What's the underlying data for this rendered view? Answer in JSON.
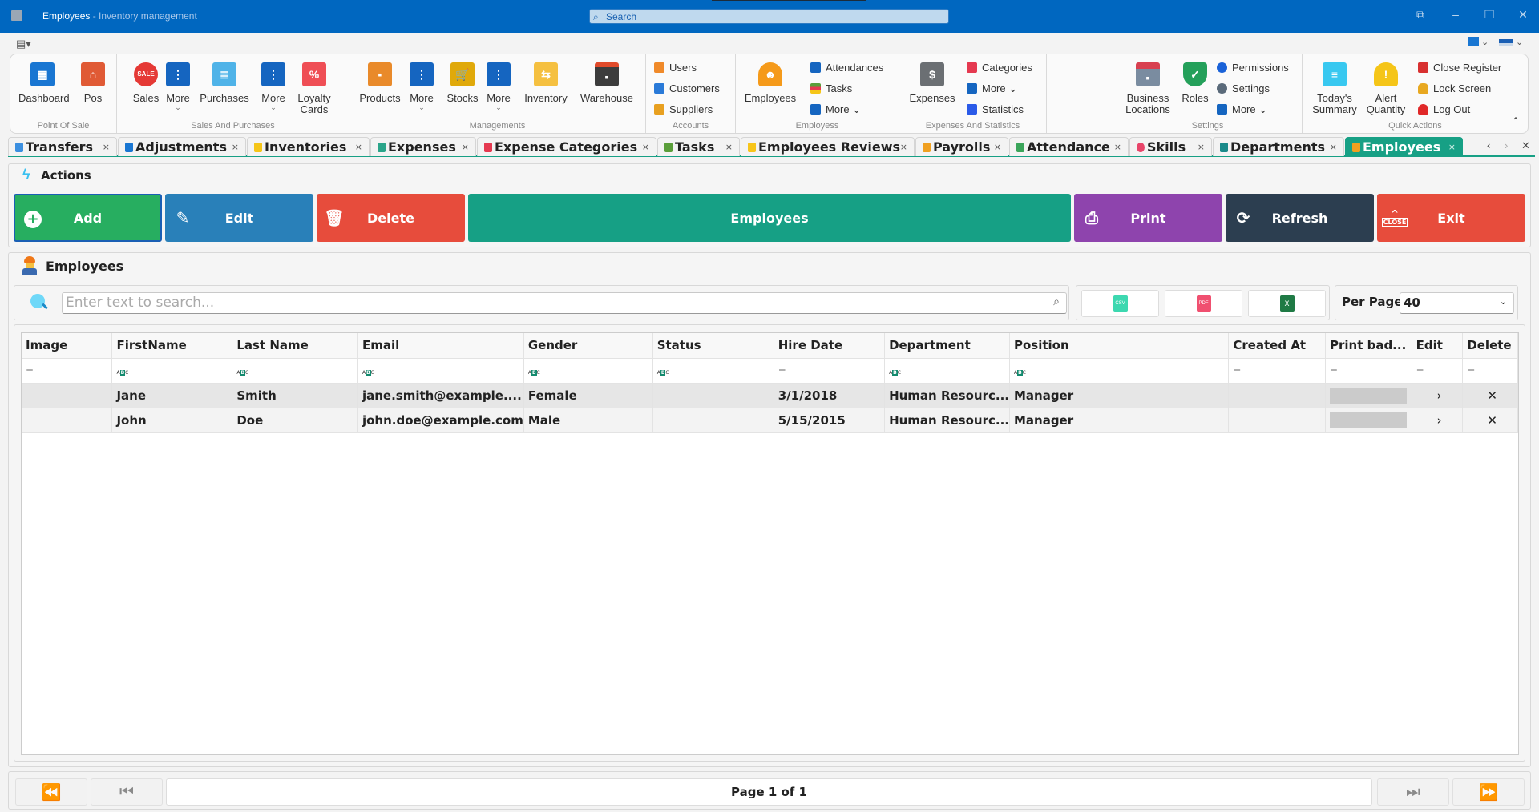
{
  "window": {
    "title": "Employees",
    "subtitle": " - Inventory management",
    "search_placeholder": "Search",
    "controls": {
      "restore_icon": "⧉",
      "minimize": "–",
      "maximize": "❐",
      "close": "✕"
    }
  },
  "ribbon": {
    "groups": [
      {
        "caption": "Point Of Sale",
        "items": [
          {
            "label": "Dashboard"
          },
          {
            "label": "Pos"
          }
        ]
      },
      {
        "caption": "Sales And Purchases",
        "items": [
          {
            "label": "Sales"
          },
          {
            "label": "More"
          },
          {
            "label": "Purchases"
          },
          {
            "label": "More"
          },
          {
            "label": "Loyalty Cards"
          }
        ]
      },
      {
        "caption": "Managements",
        "items": [
          {
            "label": "Products"
          },
          {
            "label": "More"
          },
          {
            "label": "Stocks"
          },
          {
            "label": "More"
          },
          {
            "label": "Inventory"
          },
          {
            "label": "Warehouse"
          }
        ]
      },
      {
        "caption": "Accounts",
        "items": [
          {
            "label": "Users"
          },
          {
            "label": "Customers"
          },
          {
            "label": "Suppliers"
          }
        ]
      },
      {
        "caption": "Employess",
        "items": [
          {
            "label": "Employees"
          },
          {
            "label": "Attendances"
          },
          {
            "label": "Tasks"
          },
          {
            "label": "More ⌄"
          }
        ]
      },
      {
        "caption": "Expenses And Statistics",
        "items": [
          {
            "label": "Expenses"
          },
          {
            "label": "Categories"
          },
          {
            "label": "More ⌄"
          },
          {
            "label": "Statistics"
          }
        ]
      },
      {
        "caption": "Settings",
        "items": [
          {
            "label": "Business Locations"
          },
          {
            "label": "Roles"
          },
          {
            "label": "Permissions"
          },
          {
            "label": "Settings"
          },
          {
            "label": "More ⌄"
          }
        ]
      },
      {
        "caption": "Quick Actions",
        "items": [
          {
            "label": "Today's Summary"
          },
          {
            "label": "Alert Quantity"
          },
          {
            "label": "Close Register"
          },
          {
            "label": "Lock Screen"
          },
          {
            "label": "Log Out"
          }
        ]
      }
    ]
  },
  "tabs": [
    {
      "label": "Transfers",
      "color": "#3b8fe0"
    },
    {
      "label": "Adjustments",
      "color": "#1976d2"
    },
    {
      "label": "Inventories",
      "color": "#f5c518"
    },
    {
      "label": "Expenses",
      "color": "#2aa58a"
    },
    {
      "label": "Expense Categories",
      "color": "#e53950"
    },
    {
      "label": "Tasks",
      "color": "#5a9e3a"
    },
    {
      "label": "Employees Reviews",
      "color": "#f7c51a"
    },
    {
      "label": "Payrolls",
      "color": "#f0a020"
    },
    {
      "label": "Attendance",
      "color": "#3aa55a"
    },
    {
      "label": "Skills",
      "color": "#e8456a"
    },
    {
      "label": "Departments",
      "color": "#1a8a8a"
    },
    {
      "label": "Employees",
      "color": "#f0a020",
      "active": true
    }
  ],
  "tab_close": "×",
  "tab_nav": {
    "prev": "‹",
    "next": "›",
    "close": "✕"
  },
  "actions": {
    "title": "Actions",
    "buttons": [
      {
        "label": "Add",
        "color": "#27ae60"
      },
      {
        "label": "Edit",
        "color": "#2980b9"
      },
      {
        "label": "Delete",
        "color": "#e74c3c"
      },
      {
        "label": "Employees",
        "color": "#16a085"
      },
      {
        "label": "Print",
        "color": "#8e44ad"
      },
      {
        "label": "Refresh",
        "color": "#2c3e50"
      },
      {
        "label": "Exit",
        "color": "#e74c3c"
      }
    ]
  },
  "employees_panel": {
    "title": "Employees",
    "search_placeholder": "Enter text to search...",
    "export": {
      "csv": "CSV",
      "pdf": "PDF",
      "excel": "X"
    },
    "per_page_label": "Per Page",
    "per_page_value": "40"
  },
  "table": {
    "columns": [
      "Image",
      "FirstName",
      "Last Name",
      "Email",
      "Gender",
      "Status",
      "Hire Date",
      "Department",
      "Position",
      "Created At",
      "Print bad...",
      "Edit",
      "Delete"
    ],
    "filter_types": [
      "=",
      "abc",
      "abc",
      "abc",
      "abc",
      "abc",
      "=",
      "abc",
      "abc",
      "=",
      "=",
      "=",
      "="
    ],
    "rows": [
      {
        "image": "",
        "first_name": "Jane",
        "last_name": "Smith",
        "email": "jane.smith@example....",
        "gender": "Female",
        "status": "",
        "hire_date": "3/1/2018",
        "department": "Human Resourc...",
        "position": "Manager",
        "created_at": "",
        "edit": "›",
        "delete": "✕"
      },
      {
        "image": "",
        "first_name": "John",
        "last_name": "Doe",
        "email": "john.doe@example.com",
        "gender": "Male",
        "status": "",
        "hire_date": "5/15/2015",
        "department": "Human Resourc...",
        "position": "Manager",
        "created_at": "",
        "edit": "›",
        "delete": "✕"
      }
    ]
  },
  "pager": {
    "info": "Page 1 of 1",
    "first": "⏪",
    "prev": "⏮",
    "next": "⏭",
    "last": "⏩"
  }
}
